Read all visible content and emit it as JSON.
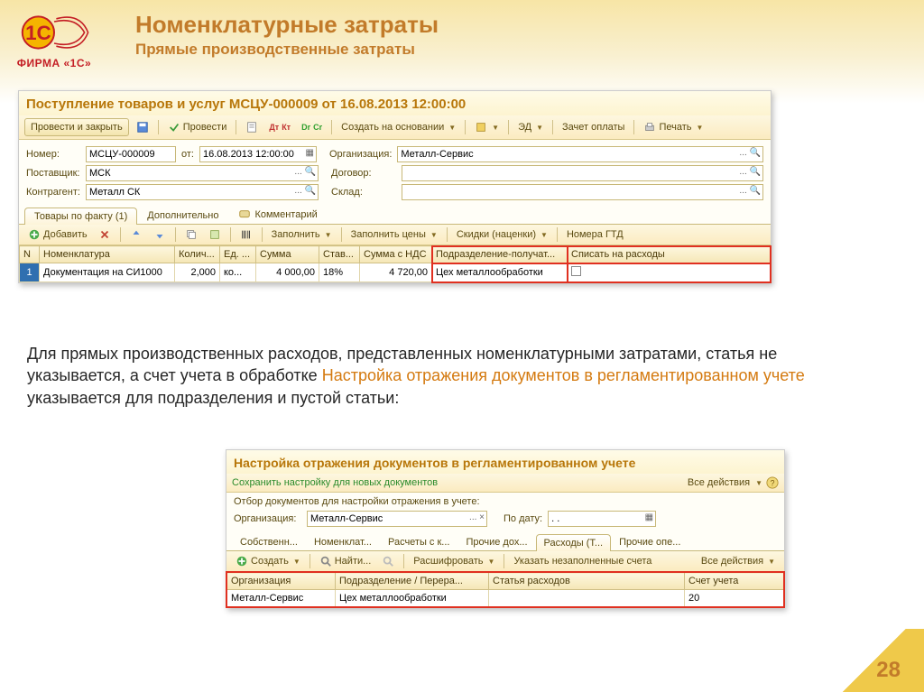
{
  "logo": {
    "caption": "ФИРМА «1С»"
  },
  "header": {
    "title": "Номенклатурные затраты",
    "subtitle": "Прямые производственные затраты"
  },
  "win1": {
    "title": "Поступление товаров и услуг МСЦУ-000009 от 16.08.2013 12:00:00",
    "toolbar": {
      "post_close": "Провести и закрыть",
      "post": "Провести",
      "create_based": "Создать на основании",
      "ed": "ЭД",
      "offset": "Зачет оплаты",
      "print": "Печать"
    },
    "fields": {
      "number_lbl": "Номер:",
      "number_val": "МСЦУ-000009",
      "date_lbl": "от:",
      "date_val": "16.08.2013 12:00:00",
      "org_lbl": "Организация:",
      "org_val": "Металл-Сервис",
      "supplier_lbl": "Поставщик:",
      "supplier_val": "МСК",
      "contract_lbl": "Договор:",
      "contragent_lbl": "Контрагент:",
      "contragent_val": "Металл СК",
      "sklad_lbl": "Склад:"
    },
    "tabs": {
      "t1": "Товары по факту (1)",
      "t2": "Дополнительно",
      "t3": "Комментарий"
    },
    "grid_toolbar": {
      "add": "Добавить",
      "fill": "Заполнить",
      "fill_prices": "Заполнить цены",
      "discounts": "Скидки (наценки)",
      "gtd": "Номера ГТД"
    },
    "columns": {
      "n": "N",
      "nomen": "Номенклатура",
      "qty": "Колич...",
      "unit": "Ед. ...",
      "sum": "Сумма",
      "rate": "Став...",
      "sum_vat": "Сумма с НДС",
      "dept": "Подразделение-получат...",
      "writeoff": "Списать на расходы"
    },
    "row": {
      "n": "1",
      "nomen": "Документация на СИ1000",
      "qty": "2,000",
      "unit": "ко...",
      "sum": "4 000,00",
      "rate": "18%",
      "sum_vat": "4 720,00",
      "dept": "Цех металлообработки"
    }
  },
  "paragraph": {
    "p1": "Для прямых производственных расходов, представленных номенклатурными затратами, статья не указывается, а счет учета в обработке ",
    "p2": "Настройка отражения документов в регламентированном учете",
    "p3": " указывается для подразделения и пустой статьи:"
  },
  "win2": {
    "title": "Настройка отражения документов в регламентированном учете",
    "save_link": "Сохранить настройку для новых документов",
    "all_actions": "Все действия",
    "filter_label": "Отбор документов для настройки отражения в учете:",
    "org_lbl": "Организация:",
    "org_val": "Металл-Сервис",
    "date_lbl": "По дату:",
    "date_val": ". .",
    "tabs": {
      "t1": "Собственн...",
      "t2": "Номенклат...",
      "t3": "Расчеты с к...",
      "t4": "Прочие дох...",
      "t5": "Расходы (Т...",
      "t6": "Прочие опе..."
    },
    "toolbar2": {
      "create": "Создать",
      "find": "Найти...",
      "decode": "Расшифровать",
      "unfilled": "Указать незаполненные счета",
      "all": "Все действия"
    },
    "columns": {
      "org": "Организация",
      "dept": "Подразделение / Перера...",
      "article": "Статья расходов",
      "account": "Счет учета"
    },
    "row": {
      "org": "Металл-Сервис",
      "dept": "Цех металлообработки",
      "article": "",
      "account": "20"
    }
  },
  "page_number": "28"
}
